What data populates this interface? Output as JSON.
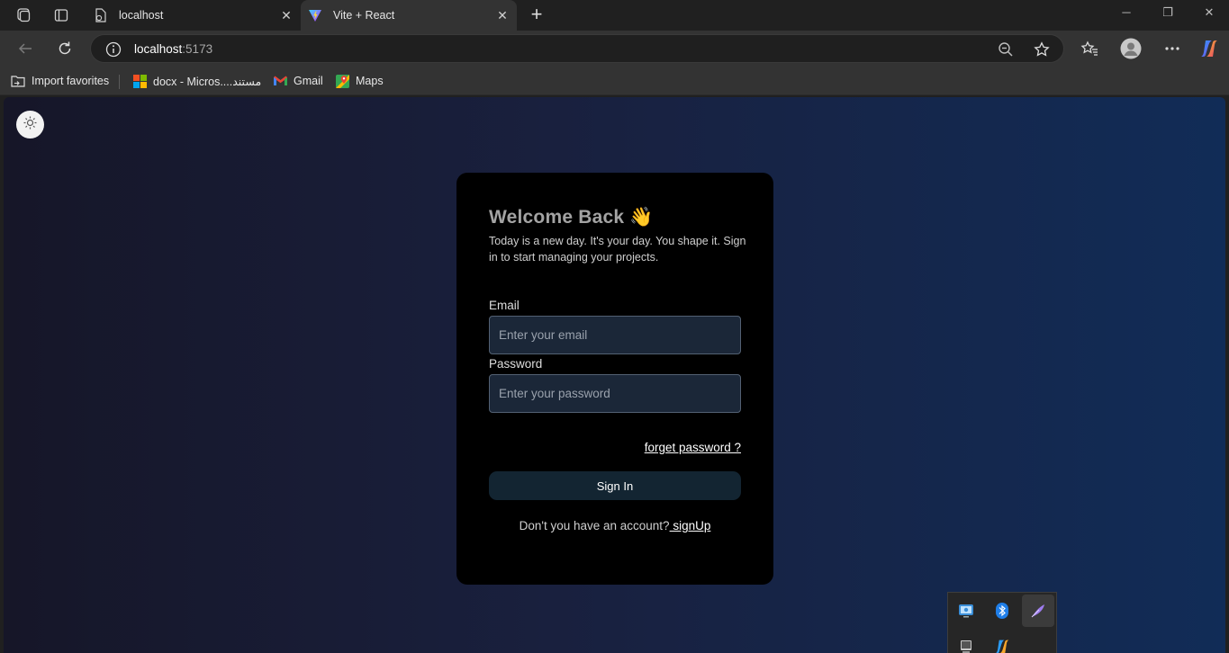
{
  "browser": {
    "tabs": [
      {
        "title": "localhost",
        "favicon": "page-icon"
      },
      {
        "title": "Vite + React",
        "favicon": "vite-logo-icon"
      }
    ],
    "url_host": "localhost",
    "url_port": ":5173",
    "favorites": [
      {
        "label": "Import favorites",
        "icon": "import-folder-icon"
      },
      {
        "label": "docx - Micros....مستند",
        "icon": "microsoft-logo-icon"
      },
      {
        "label": "Gmail",
        "icon": "gmail-icon"
      },
      {
        "label": "Maps",
        "icon": "maps-icon"
      }
    ]
  },
  "page": {
    "theme_toggle_icon": "sun-icon",
    "title": "Welcome Back",
    "title_emoji": "👋",
    "subtitle": "Today is a new day. It's your day. You shape it. Sign in to start managing your projects.",
    "email_label": "Email",
    "email_placeholder": "Enter your email",
    "password_label": "Password",
    "password_placeholder": "Enter your password",
    "forget_password": "forget password ?",
    "sign_in": "Sign In",
    "no_account": "Don't you have an account?",
    "sign_up": " signUp"
  },
  "colors": {
    "card_bg": "#000000",
    "input_bg": "#1b2738",
    "button_bg": "#132532",
    "gradient_left": "#161628",
    "gradient_right": "#112c57"
  }
}
